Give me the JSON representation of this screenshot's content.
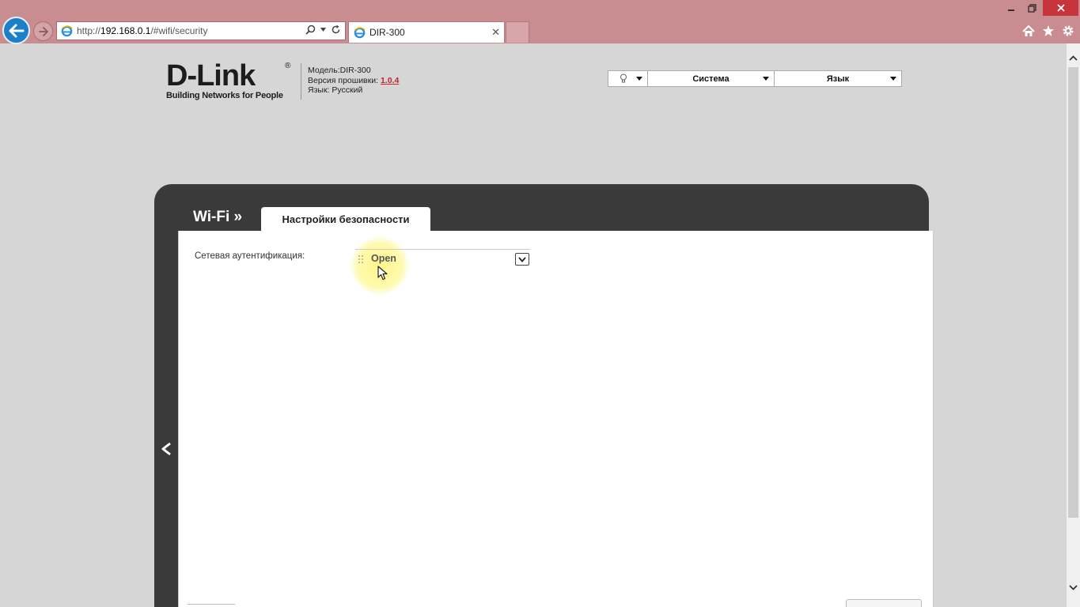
{
  "browser": {
    "address_url_prefix": "http://",
    "address_url_host": "192.168.0.1",
    "address_url_path": "/#wifi/security",
    "tab_title": "DIR-300",
    "colors": {
      "chrome": "#c98c90",
      "back_button": "#1b7fc9",
      "close_button": "#c7343c"
    }
  },
  "header": {
    "logo_text": "D-Link",
    "logo_tagline": "Building Networks for People",
    "model_label": "Модель:",
    "model_value": "DIR-300",
    "firmware_label": "Версия прошивки:",
    "firmware_value": "1.0.4",
    "language_label": "Язык:",
    "language_value": "Русский"
  },
  "top_menu": {
    "items": [
      {
        "label": "",
        "icon": "bulb-icon"
      },
      {
        "label": "Система"
      },
      {
        "label": "Язык"
      }
    ]
  },
  "panel": {
    "section_title": "Wi-Fi »",
    "active_tab": "Настройки безопасности"
  },
  "form": {
    "auth_label": "Сетевая аутентификация:",
    "auth_value": "Open"
  }
}
